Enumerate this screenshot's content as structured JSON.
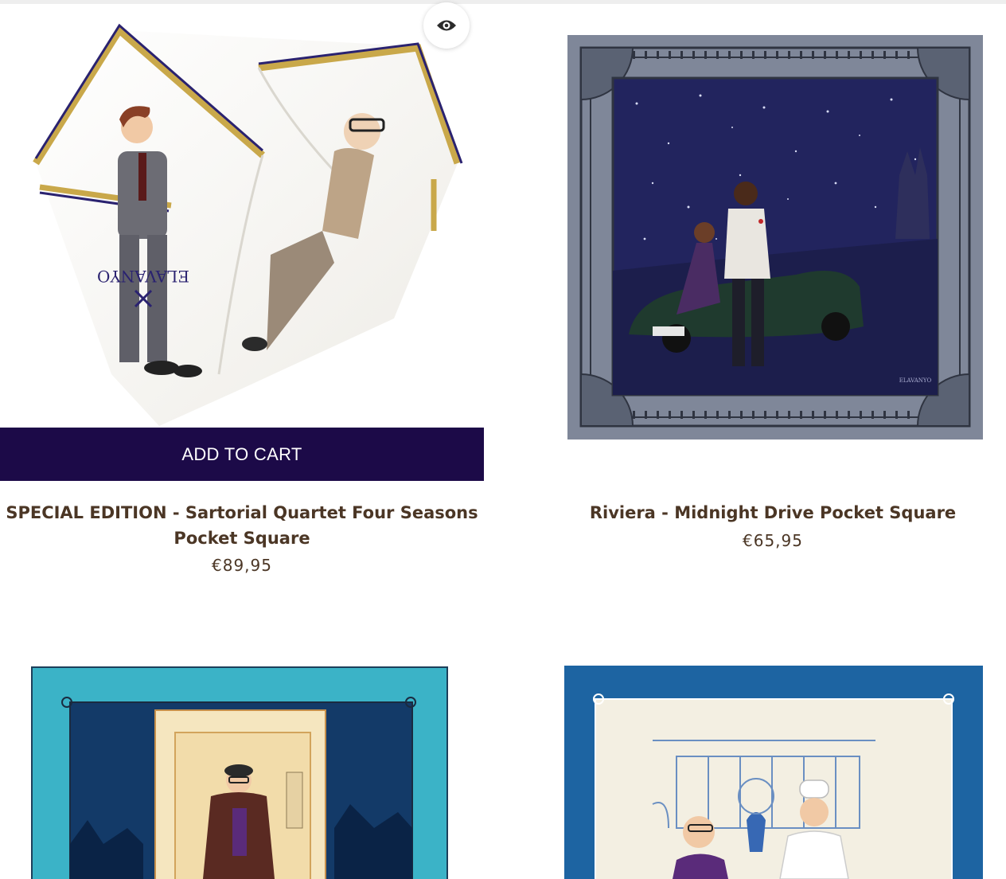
{
  "products": [
    {
      "title": "SPECIAL EDITION - Sartorial Quartet Four Seasons Pocket Square",
      "price": "€89,95",
      "add_to_cart_label": "ADD TO CART",
      "image_brand_mark": "ELAVANYO"
    },
    {
      "title": "Riviera - Midnight Drive Pocket Square",
      "price": "€65,95",
      "image_brand_mark": "ELAVANYO"
    },
    {
      "title": "",
      "price": ""
    },
    {
      "title": "",
      "price": ""
    }
  ],
  "icons": {
    "quick_view": "eye-icon"
  },
  "colors": {
    "add_to_cart_bg": "#1c0a48",
    "text_brown": "#4b3625",
    "navy_sky": "#22245e",
    "teal_border": "#3bb3c7",
    "blue_border": "#1d64a2"
  }
}
